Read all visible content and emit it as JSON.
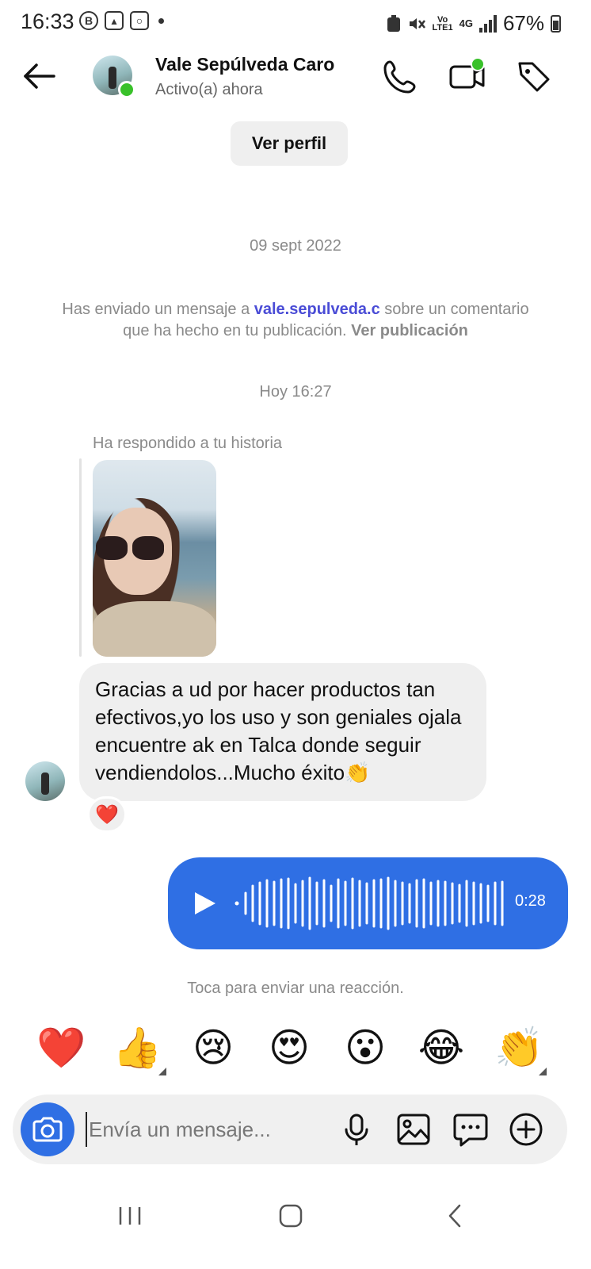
{
  "status_bar": {
    "time": "16:33",
    "left_icons": [
      "b-badge-icon",
      "gallery-icon",
      "instagram-icon"
    ],
    "network_small_top": "Vo",
    "network_small_bottom": "LTE1",
    "network_type": "4G",
    "battery_percent": "67%"
  },
  "header": {
    "contact_name": "Vale Sepúlveda Caro",
    "contact_status": "Activo(a) ahora",
    "online": true,
    "accent_green": "#39c12a"
  },
  "view_profile_label": "Ver perfil",
  "date_separator_1": "09 sept 2022",
  "info_message": {
    "prefix": "Has enviado un mensaje a ",
    "username": "vale.sepulveda.c",
    "middle": " sobre un comentario que ha hecho en tu publicación. ",
    "view_post": "Ver publicación"
  },
  "date_separator_2": "Hoy 16:27",
  "story_reply_label": "Ha respondido a tu historia",
  "incoming_message": {
    "text": "Gracias a ud por hacer productos tan efectivos,yo los uso y son geniales ojala encuentre ak en Talca donde seguir vendiendolos...Mucho éxito👏",
    "reaction": "❤️"
  },
  "voice_message": {
    "duration": "0:28",
    "bubble_color": "#2f6fe4"
  },
  "reaction_hint": "Toca para enviar una reacción.",
  "quick_reactions": [
    "❤️",
    "👍",
    "😢",
    "😍",
    "😮",
    "😂",
    "👏"
  ],
  "composer": {
    "placeholder": "Envía un mensaje..."
  }
}
